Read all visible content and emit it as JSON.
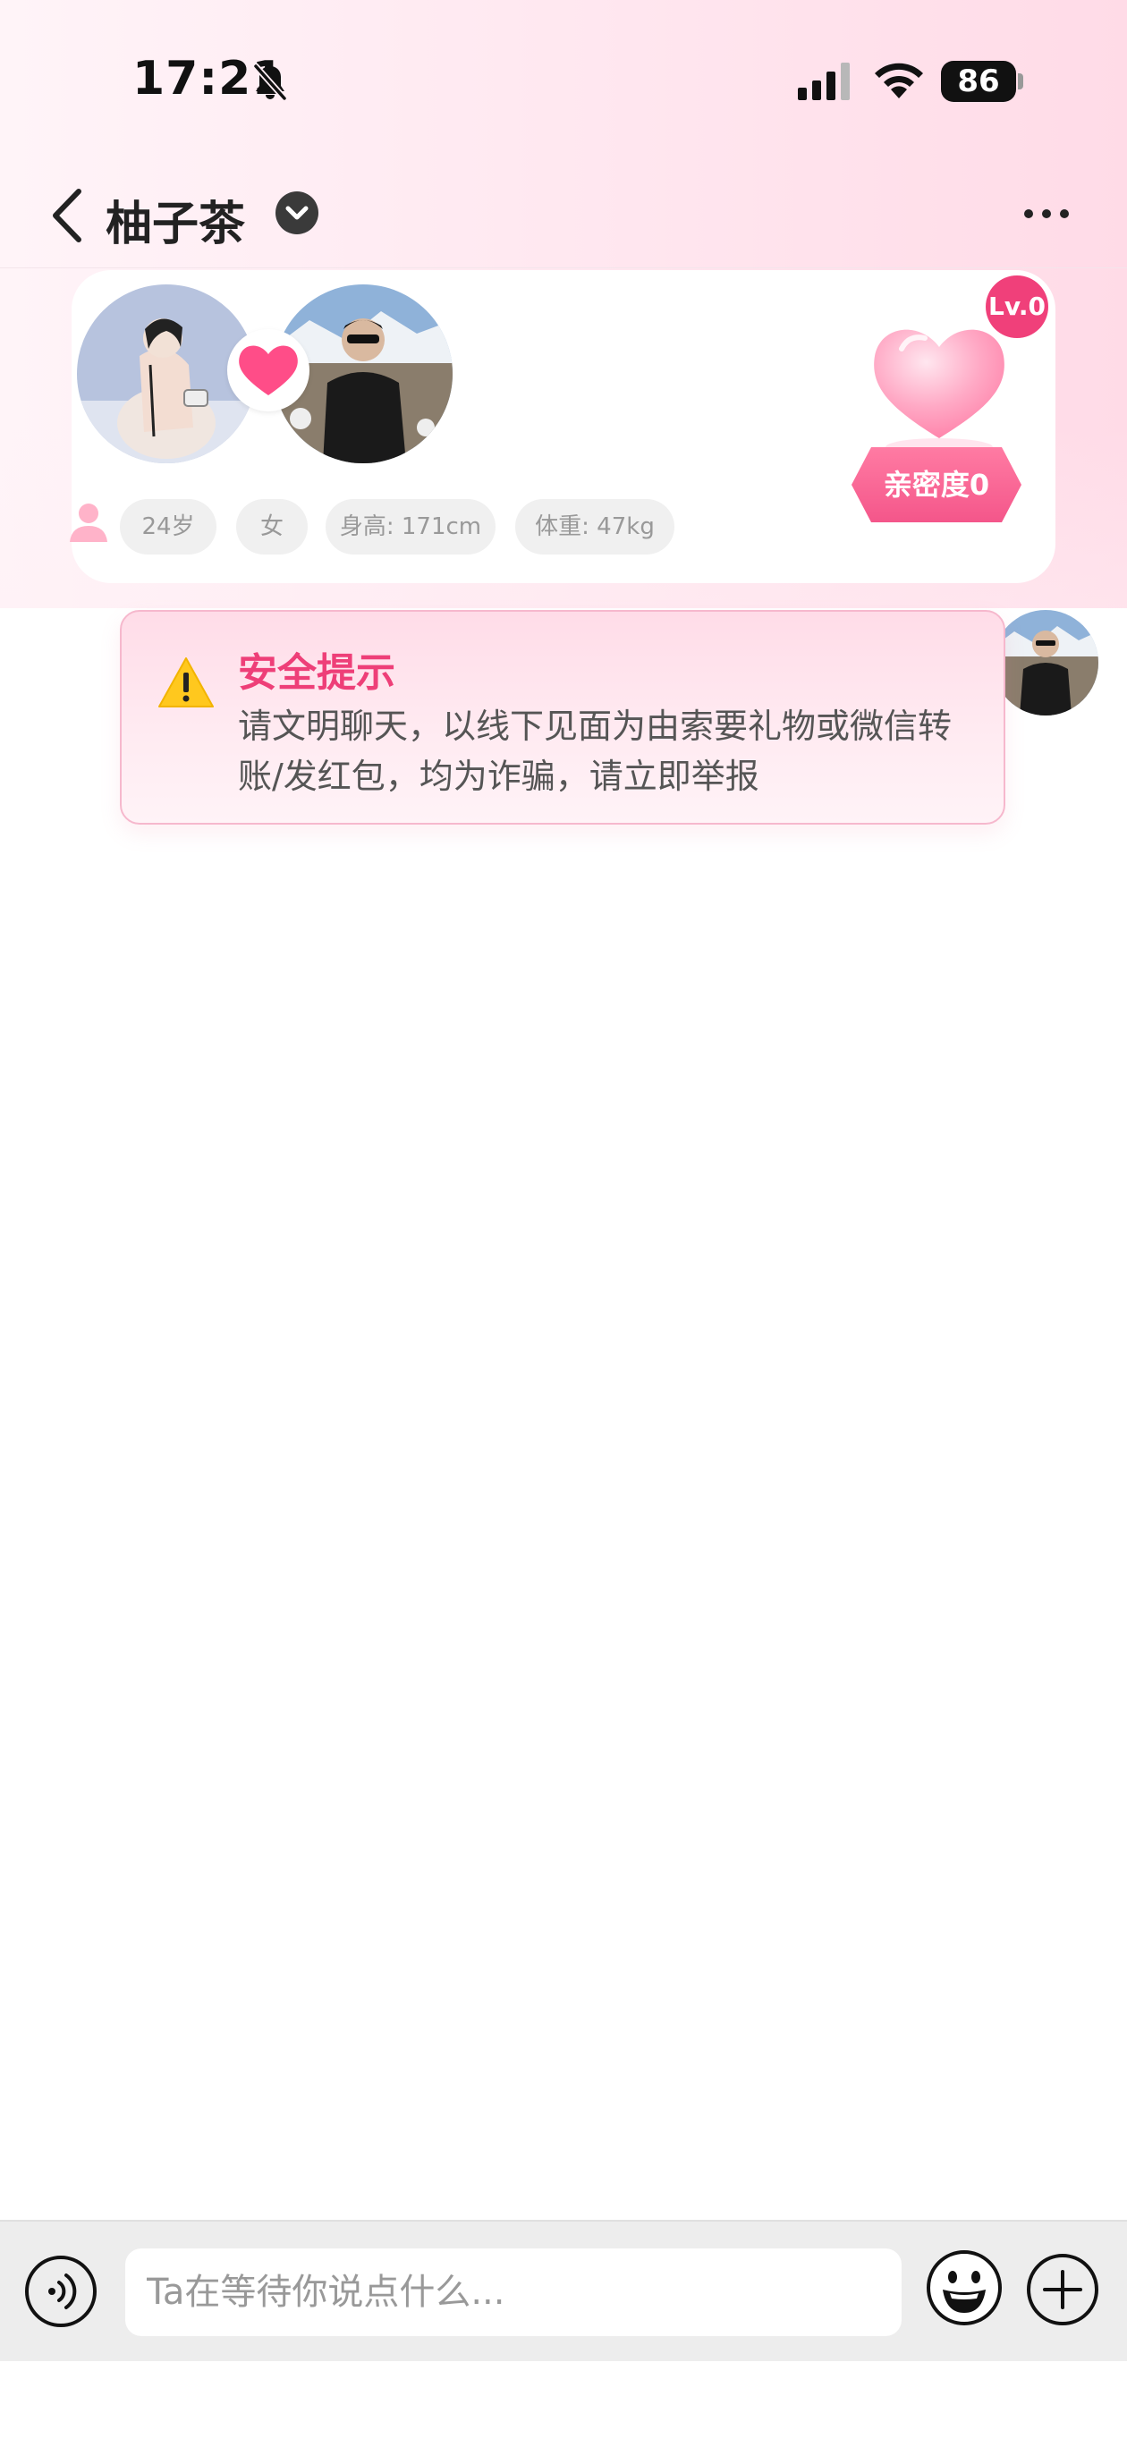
{
  "status_bar": {
    "time": "17:21",
    "battery": "86",
    "icons": [
      "bell-off-icon",
      "cell-signal-icon",
      "wifi-icon",
      "battery-icon"
    ]
  },
  "nav": {
    "title": "柚子茶",
    "icons": [
      "chevron-left-icon",
      "chevron-down-icon",
      "more-icon"
    ]
  },
  "profile": {
    "level": "Lv.0",
    "intimacy": "亲密度0",
    "tags": {
      "age": "24岁",
      "gender": "女",
      "height": "身高: 171cm",
      "weight": "体重: 47kg"
    }
  },
  "safety_tip": {
    "title": "安全提示",
    "body": "请文明聊天，以线下见面为由索要礼物或微信转账/发红包，均为诈骗，请立即举报"
  },
  "input": {
    "placeholder": "Ta在等待你说点什么..."
  },
  "colors": {
    "accent": "#ee3f78",
    "badge": "#f0407a",
    "heart": "#ff4d88",
    "tip_border": "#f6b8cd",
    "input_bar": "#ededed"
  }
}
